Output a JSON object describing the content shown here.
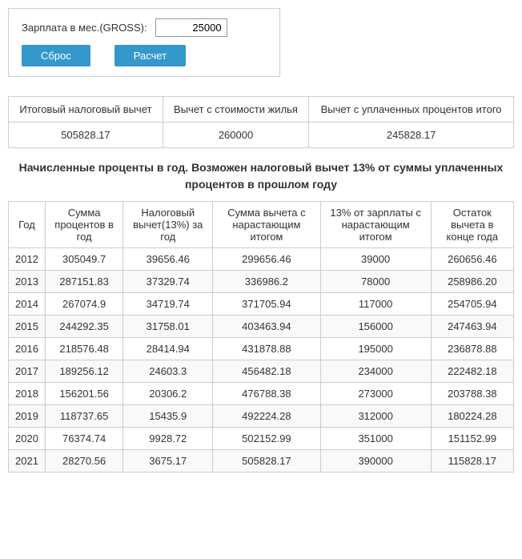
{
  "form": {
    "salary_label": "Зарплата в мес.(GROSS):",
    "salary_value": "25000",
    "reset_label": "Сброс",
    "calc_label": "Расчет"
  },
  "summary": {
    "col1_header": "Итоговый налоговый вычет",
    "col2_header": "Вычет с стоимости жилья",
    "col3_header": "Вычет с уплаченных процентов итого",
    "col1_value": "505828.17",
    "col2_value": "260000",
    "col3_value": "245828.17"
  },
  "notice": "Начисленные проценты в год. Возможен налоговый вычет 13% от суммы уплаченных процентов в прошлом году",
  "table": {
    "headers": [
      "Год",
      "Сумма процентов в год",
      "Налоговый вычет(13%) за год",
      "Сумма вычета с нарастающим итогом",
      "13% от зарплаты с нарастающим итогом",
      "Остаток вычета в конце года"
    ],
    "rows": [
      [
        "2012",
        "305049.7",
        "39656.46",
        "299656.46",
        "39000",
        "260656.46"
      ],
      [
        "2013",
        "287151.83",
        "37329.74",
        "336986.2",
        "78000",
        "258986.20"
      ],
      [
        "2014",
        "267074.9",
        "34719.74",
        "371705.94",
        "117000",
        "254705.94"
      ],
      [
        "2015",
        "244292.35",
        "31758.01",
        "403463.94",
        "156000",
        "247463.94"
      ],
      [
        "2016",
        "218576.48",
        "28414.94",
        "431878.88",
        "195000",
        "236878.88"
      ],
      [
        "2017",
        "189256.12",
        "24603.3",
        "456482.18",
        "234000",
        "222482.18"
      ],
      [
        "2018",
        "156201.56",
        "20306.2",
        "476788.38",
        "273000",
        "203788.38"
      ],
      [
        "2019",
        "118737.65",
        "15435.9",
        "492224.28",
        "312000",
        "180224.28"
      ],
      [
        "2020",
        "76374.74",
        "9928.72",
        "502152.99",
        "351000",
        "151152.99"
      ],
      [
        "2021",
        "28270.56",
        "3675.17",
        "505828.17",
        "390000",
        "115828.17"
      ]
    ]
  }
}
